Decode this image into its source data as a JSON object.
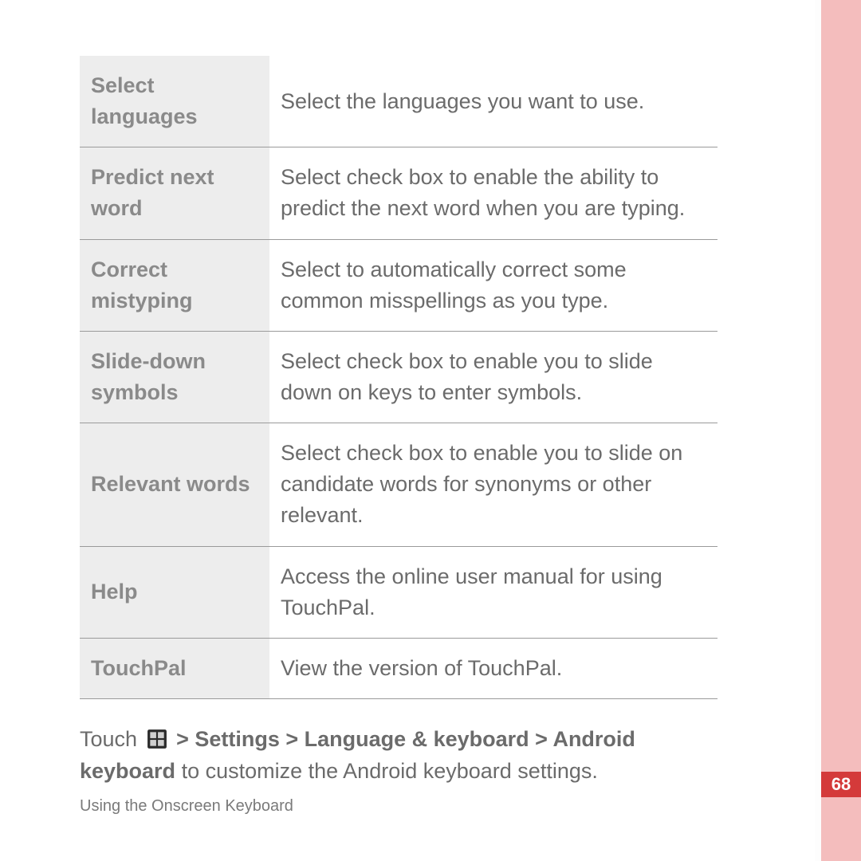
{
  "page_number": "68",
  "footer": "Using the Onscreen Keyboard",
  "rows": [
    {
      "label": "Select languages",
      "desc": "Select the languages you want to use."
    },
    {
      "label": "Predict next word",
      "desc": "Select check box to enable the ability to predict the next word when you are typing."
    },
    {
      "label": "Correct mistyping",
      "desc": "Select to automatically correct some common misspellings as you type."
    },
    {
      "label": "Slide-down symbols",
      "desc": "Select check box to enable you to slide down on keys to enter symbols."
    },
    {
      "label": "Relevant words",
      "desc": "Select check box to enable you to slide on candidate words for synonyms or other relevant."
    },
    {
      "label": "Help",
      "desc": "Access the online user manual for using TouchPal."
    },
    {
      "label": "TouchPal",
      "desc": "View the version of TouchPal."
    }
  ],
  "paragraph": {
    "pre": "Touch ",
    "bold": " > Settings > Language & keyboard > Android keyboard",
    "post": " to customize the Android keyboard settings."
  }
}
